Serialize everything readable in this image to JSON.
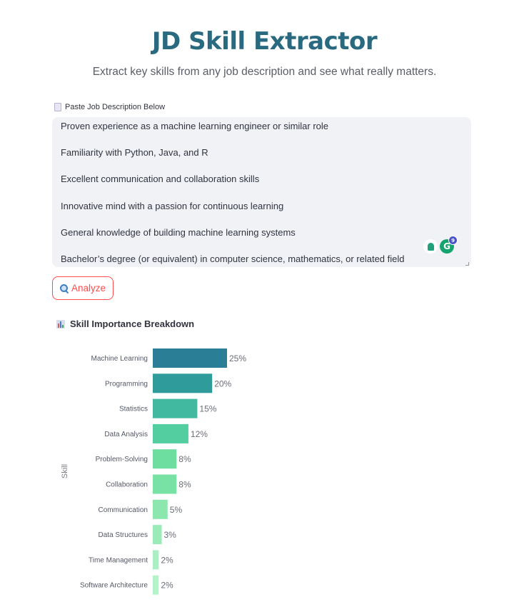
{
  "header": {
    "title": "JD Skill Extractor",
    "subtitle": "Extract key skills from any job description and see what really matters."
  },
  "input": {
    "label": "Paste Job Description Below",
    "lines": [
      "Proven experience as a machine learning engineer or similar role",
      "Familiarity with Python, Java, and R",
      "Excellent communication and collaboration skills",
      "Innovative mind with a passion for continuous learning",
      "General knowledge of building machine learning systems",
      "Bachelor’s degree (or equivalent) in computer science, mathematics, or related field"
    ],
    "extension_badge": "9"
  },
  "actions": {
    "analyze_label": "Analyze"
  },
  "section": {
    "title": "Skill Importance Breakdown"
  },
  "chart_data": {
    "type": "bar",
    "orientation": "horizontal",
    "ylabel": "Skill",
    "categories": [
      "Machine Learning",
      "Programming",
      "Statistics",
      "Data Analysis",
      "Problem-Solving",
      "Collaboration",
      "Communication",
      "Data Structures",
      "Time Management",
      "Software Architecture"
    ],
    "values": [
      25,
      20,
      15,
      12,
      8,
      8,
      5,
      3,
      2,
      2
    ],
    "labels": [
      "25%",
      "20%",
      "15%",
      "12%",
      "8%",
      "8%",
      "5%",
      "3%",
      "2%",
      "2%"
    ],
    "colors": [
      "#2a7f97",
      "#2f9c9b",
      "#40b9a0",
      "#52cea0",
      "#6dde9f",
      "#78e2a4",
      "#8be7ad",
      "#9aebb8",
      "#a9efc3",
      "#b3f2ca"
    ],
    "grid": false
  }
}
